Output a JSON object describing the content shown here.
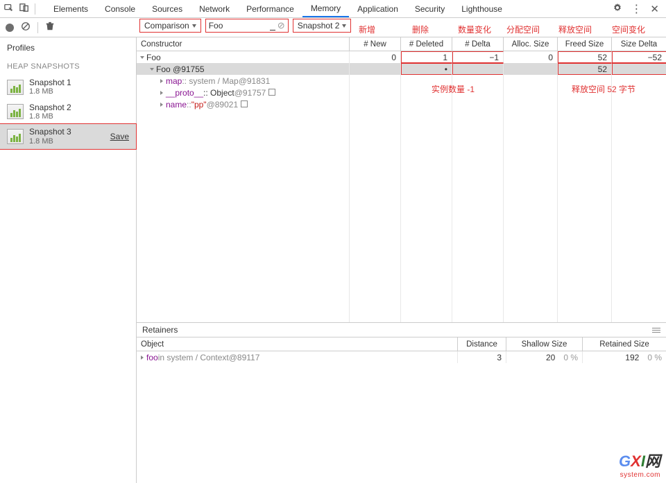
{
  "tabs": [
    "Elements",
    "Console",
    "Sources",
    "Network",
    "Performance",
    "Memory",
    "Application",
    "Security",
    "Lighthouse"
  ],
  "activeTab": "Memory",
  "toolbar": {
    "view_select": "Comparison",
    "filter_value": "Foo",
    "compare_select": "Snapshot 2"
  },
  "annotations": {
    "new": "新增",
    "deleted": "删除",
    "delta_count": "数量变化",
    "alloc": "分配空间",
    "freed": "释放空间",
    "size_delta": "空间变化",
    "instance_delta": "实例数量 -1",
    "freed_bytes": "释放空间 52 字节"
  },
  "sidebar": {
    "profiles": "Profiles",
    "heap_header": "HEAP SNAPSHOTS",
    "snapshots": [
      {
        "name": "Snapshot 1",
        "size": "1.8 MB"
      },
      {
        "name": "Snapshot 2",
        "size": "1.8 MB"
      },
      {
        "name": "Snapshot 3",
        "size": "1.8 MB"
      }
    ],
    "save": "Save"
  },
  "grid": {
    "headers": {
      "constructor": "Constructor",
      "new": "# New",
      "deleted": "# Deleted",
      "delta": "# Delta",
      "alloc": "Alloc. Size",
      "freed": "Freed Size",
      "size_delta": "Size Delta"
    },
    "rows": [
      {
        "label": "Foo",
        "new": "0",
        "deleted": "1",
        "delta": "−1",
        "alloc": "0",
        "freed": "52",
        "size_delta": "−52",
        "depth": 0,
        "open": true
      },
      {
        "label": "Foo @91755",
        "new": "",
        "deleted": "•",
        "delta": "",
        "alloc": "",
        "freed": "52",
        "size_delta": "",
        "depth": 1,
        "open": true,
        "selected": true
      },
      {
        "kind": "child",
        "prefix": "map",
        "mid": " :: system / Map ",
        "id": "@91831",
        "depth": 2
      },
      {
        "kind": "child",
        "prefix": "__proto__",
        "mid": " :: Object ",
        "id": "@91757",
        "depth": 2,
        "objlink": true
      },
      {
        "kind": "child",
        "prefix": "name",
        "mid": " :: ",
        "val": "\"pp\"",
        "id": " @89021",
        "depth": 2,
        "objlink": true
      }
    ]
  },
  "retainers": {
    "title": "Retainers",
    "headers": {
      "object": "Object",
      "distance": "Distance",
      "shallow": "Shallow Size",
      "retained": "Retained Size"
    },
    "row": {
      "prefix": "foo",
      "mid": " in system / Context ",
      "id": "@89117",
      "distance": "3",
      "shallow": "20",
      "shallow_pct": "0 %",
      "retained": "192",
      "retained_pct": "0 %"
    }
  },
  "watermark": {
    "brand": "GXI",
    "cn": "网",
    "url": "system.com"
  }
}
